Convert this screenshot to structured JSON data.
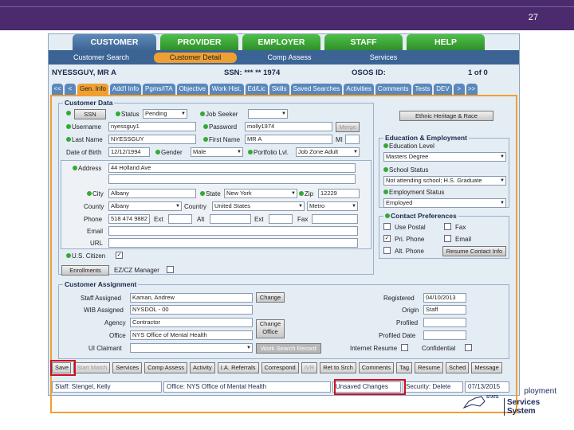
{
  "slide": {
    "page_number": "27"
  },
  "tabs": [
    "CUSTOMER",
    "PROVIDER",
    "EMPLOYER",
    "STAFF",
    "HELP"
  ],
  "subnav": [
    "Customer Search",
    "Customer Detail",
    "Comp Assess",
    "Services"
  ],
  "header": {
    "name": "NYESSGUY, MR A",
    "ssn": "SSN: *** ** 1974",
    "osos": "OSOS ID:",
    "page": "1 of 0"
  },
  "btabs": [
    "<<",
    "<",
    "Gen. Info",
    "Add'l Info",
    "Pgms/ITA",
    "Objective",
    "Work Hist.",
    "Ed/Lic",
    "Skills",
    "Saved Searches",
    "Activities",
    "Comments",
    "Tests",
    "DEV",
    ">",
    ">>"
  ],
  "customer_data": {
    "title": "Customer Data",
    "ssn_btn": "SSN",
    "status_lbl": "Status",
    "status_val": "Pending",
    "job_seeker": "Job Seeker",
    "username_lbl": "Username",
    "username_val": "nyessguy1",
    "password_lbl": "Password",
    "password_val": "molly1974",
    "merge": "Merge",
    "last_lbl": "Last Name",
    "last_val": "NYESSGUY",
    "first_lbl": "First Name",
    "first_val": "MR A",
    "mi": "MI",
    "dob_lbl": "Date of Birth",
    "dob_val": "12/12/1994",
    "gender_lbl": "Gender",
    "gender_val": "Male",
    "portfolio_lbl": "Portfolio Lvl.",
    "portfolio_val": "Job Zone Adult",
    "ethnic_btn": "Ethnic Heritage & Race",
    "address_lbl": "Address",
    "address_val": "44 Holland Ave",
    "city_lbl": "City",
    "city_val": "Albany",
    "state_lbl": "State",
    "state_val": "New York",
    "zip_lbl": "Zip",
    "zip_val": "12229",
    "county_lbl": "County",
    "county_val": "Albany",
    "country_lbl": "Country",
    "country_val": "United States",
    "metro_val": "Metro",
    "phone_lbl": "Phone",
    "phone_val": "518 474 9882",
    "ext": "Ext",
    "alt": "Alt",
    "fax": "Fax",
    "email_lbl": "Email",
    "url_lbl": "URL",
    "citizen_lbl": "U.S. Citizen",
    "enrollments": "Enrollments",
    "ez": "EZ/CZ Manager"
  },
  "education": {
    "title": "Education & Employment",
    "level_lbl": "Education Level",
    "level_val": "Masters Degree",
    "school_lbl": "School Status",
    "school_val": "Not attending school; H.S. Graduate",
    "emp_lbl": "Employment Status",
    "emp_val": "Employed"
  },
  "contact": {
    "title": "Contact Preferences",
    "use_postal": "Use Postal",
    "fax": "Fax",
    "pri_phone": "Pri. Phone",
    "email": "Email",
    "alt_phone": "Alt. Phone",
    "resume_btn": "Resume Contact Info"
  },
  "assignment": {
    "title": "Customer Assignment",
    "staff_lbl": "Staff Assigned",
    "staff_val": "Kaman, Andrew",
    "change": "Change",
    "wib_lbl": "WIB Assigned",
    "wib_val": "NYSDOL - 00",
    "agency_lbl": "Agency",
    "agency_val": "Contractor",
    "office_lbl": "Office",
    "office_val": "NYS Office of Mental Health",
    "change_office": "Change Office",
    "ui_lbl": "UI Claimant",
    "work_search": "Work Search Record",
    "registered_lbl": "Registered",
    "registered_val": "04/10/2013",
    "origin_lbl": "Origin",
    "origin_val": "Staff",
    "profiled_lbl": "Profiled",
    "profiled_date_lbl": "Profiled Date",
    "internet_lbl": "Internet Resume",
    "confidential_lbl": "Confidential"
  },
  "bottom_buttons": [
    "Save",
    "Start Match",
    "Services",
    "Comp Assess",
    "Activity",
    "I.A. Referrals",
    "Correspond",
    "IVR",
    "Ret to Srch",
    "Comments",
    "Tag",
    "Resume",
    "Sched",
    "Message"
  ],
  "status": {
    "staff": "Staff: Stengel, Kelly",
    "office": "Office: NYS Office of Mental Health",
    "unsaved": "Unsaved Changes",
    "security": "Security: Delete",
    "date": "07/13/2015"
  },
  "logo": {
    "line1": "ployment",
    "line2": "Services System",
    "state": "STATE"
  },
  "colors": {
    "header_bg": "#4b2b6e",
    "tab_green": "#2f8f2a",
    "nav_blue": "#3b6495",
    "highlight_orange": "#f0a030",
    "annotation_red": "#d01020"
  }
}
